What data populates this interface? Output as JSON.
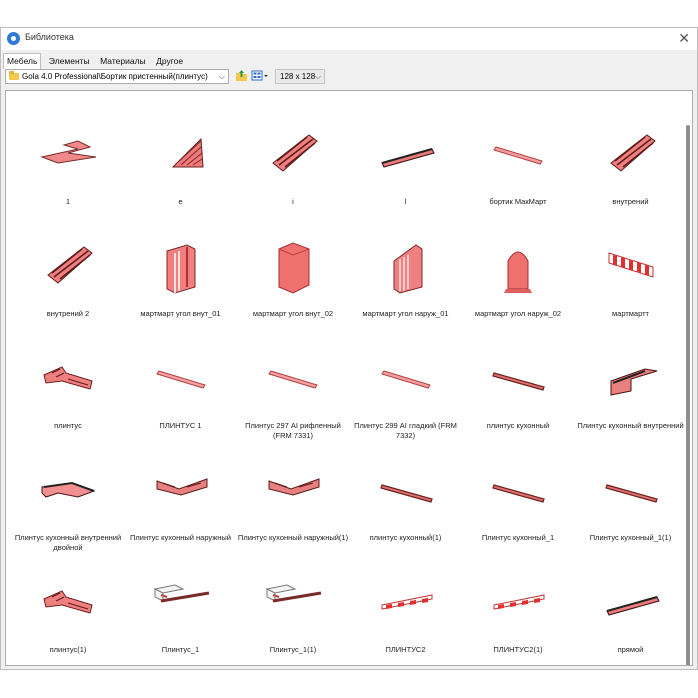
{
  "window": {
    "title": "Библиотека",
    "close_label": "✕"
  },
  "tabs": [
    {
      "label": "Мебель",
      "active": true
    },
    {
      "label": "Элементы"
    },
    {
      "label": "Материалы"
    },
    {
      "label": "Другое"
    }
  ],
  "toolbar": {
    "path": "Gola 4.0 Professional\\Бортик пристенный(плинтус)",
    "size": "128 x 128"
  },
  "items": [
    {
      "label": "1",
      "shape": "zigzag"
    },
    {
      "label": "e",
      "shape": "stair"
    },
    {
      "label": "i",
      "shape": "stair2"
    },
    {
      "label": "l",
      "shape": "bar-dark"
    },
    {
      "label": "бортик МакМарт",
      "shape": "bar-thin"
    },
    {
      "label": "внутрений",
      "shape": "stair2"
    },
    {
      "label": "внутрений 2",
      "shape": "stair2"
    },
    {
      "label": "мартмарт угол внут_01",
      "shape": "block-stripe"
    },
    {
      "label": "мартмарт угол внут_02",
      "shape": "block"
    },
    {
      "label": "мартмарт угол наруж_01",
      "shape": "block-stripe2"
    },
    {
      "label": "мартмарт угол наруж_02",
      "shape": "dome"
    },
    {
      "label": "мартмартт",
      "shape": "checker"
    },
    {
      "label": "плинтус",
      "shape": "corner"
    },
    {
      "label": "ПЛИНТУС 1",
      "shape": "bar-thin"
    },
    {
      "label": "Плинтус 297 AI рифленный (FRM 7331)",
      "shape": "bar-thin"
    },
    {
      "label": "Плинтус 299 AI гладкий (FRM 7332)",
      "shape": "bar-thin"
    },
    {
      "label": "плинтус кухонный",
      "shape": "bar-mid"
    },
    {
      "label": "Плинтус кухонный внутренний",
      "shape": "corner2"
    },
    {
      "label": "Плинтус кухонный внутренний двойной",
      "shape": "corner3"
    },
    {
      "label": "Плинтус кухонный наружный",
      "shape": "vshape"
    },
    {
      "label": "Плинтус кухонный наружный(1)",
      "shape": "vshape"
    },
    {
      "label": "плинтус кухонный(1)",
      "shape": "bar-mid"
    },
    {
      "label": "Плинтус кухонный_1",
      "shape": "bar-mid"
    },
    {
      "label": "Плинтус кухонный_1(1)",
      "shape": "bar-mid"
    },
    {
      "label": "плинтус(1)",
      "shape": "corner"
    },
    {
      "label": "Плинтус_1",
      "shape": "box-line"
    },
    {
      "label": "Плинтус_1(1)",
      "shape": "box-line"
    },
    {
      "label": "ПЛИНТУС2",
      "shape": "checker-bar"
    },
    {
      "label": "ПЛИНТУС2(1)",
      "shape": "checker-bar"
    },
    {
      "label": "прямой",
      "shape": "bar-dark"
    }
  ]
}
